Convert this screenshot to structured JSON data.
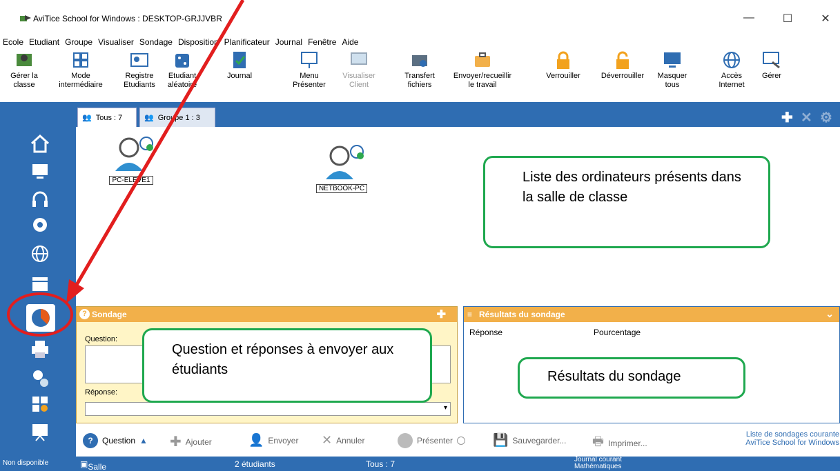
{
  "window": {
    "title": "AviTice School for Windows : DESKTOP-GRJJVBR"
  },
  "menu": [
    "Ecole",
    "Etudiant",
    "Groupe",
    "Visualiser",
    "Sondage",
    "Disposition",
    "Planificateur",
    "Journal",
    "Fenêtre",
    "Aide"
  ],
  "toolbar": {
    "items": [
      {
        "label1": "Gérer la",
        "label2": "classe",
        "icon": "manage-class-icon"
      },
      {
        "label1": "Mode",
        "label2": "intermédiaire",
        "icon": "grid-mode-icon"
      },
      {
        "label1": "Registre",
        "label2": "Etudiants",
        "icon": "student-register-icon"
      },
      {
        "label1": "Etudiant",
        "label2": "aléatoire",
        "icon": "dice-icon"
      },
      {
        "label1": "Journal",
        "label2": "",
        "icon": "journal-icon"
      },
      {
        "label1": "Menu",
        "label2": "Présenter",
        "icon": "present-menu-icon"
      },
      {
        "label1": "Visualiser",
        "label2": "Client",
        "icon": "view-client-icon"
      },
      {
        "label1": "Transfert",
        "label2": "fichiers",
        "icon": "file-transfer-icon"
      },
      {
        "label1": "Envoyer/recueillir",
        "label2": "le travail",
        "icon": "briefcase-icon"
      },
      {
        "label1": "Verrouiller",
        "label2": "",
        "icon": "lock-icon"
      },
      {
        "label1": "Déverrouiller",
        "label2": "",
        "icon": "unlock-icon"
      },
      {
        "label1": "Masquer",
        "label2": "tous",
        "icon": "monitor-icon"
      },
      {
        "label1": "Accès",
        "label2": "Internet",
        "icon": "globe-icon"
      },
      {
        "label1": "Gérer",
        "label2": "",
        "icon": "manage-tools-icon"
      }
    ]
  },
  "tabs": [
    {
      "label": "Tous : 7"
    },
    {
      "label": "Groupe 1 : 3"
    }
  ],
  "computers": [
    {
      "name": "PC-ELEVE1"
    },
    {
      "name": "NETBOOK-PC"
    }
  ],
  "callouts": {
    "computers": "Liste des ordinateurs présents dans la salle de classe",
    "question": "Question et réponses à envoyer aux étudiants",
    "results": "Résultats du sondage"
  },
  "survey": {
    "title": "Sondage",
    "question_label": "Question:",
    "answer_label": "Réponse:"
  },
  "results": {
    "title": "Résultats du sondage",
    "col_answer": "Réponse",
    "col_percent": "Pourcentage"
  },
  "bottombar": {
    "question": "Question",
    "add": "Ajouter",
    "send": "Envoyer",
    "cancel": "Annuler",
    "present": "Présenter",
    "save": "Sauvegarder...",
    "print": "Imprimer...",
    "list_line1": "Liste de sondages courante",
    "list_line2": "AviTice School for Windows"
  },
  "status": {
    "left": "Non disponible",
    "room": "Salle Bada",
    "students": "2 étudiants",
    "all": "Tous : 7",
    "journal": "Journal courant Mathématiques"
  },
  "colors": {
    "primary": "#2f6db2",
    "accent": "#f2b04a",
    "callout": "#1fa84f",
    "annotation": "#e21e1e"
  }
}
